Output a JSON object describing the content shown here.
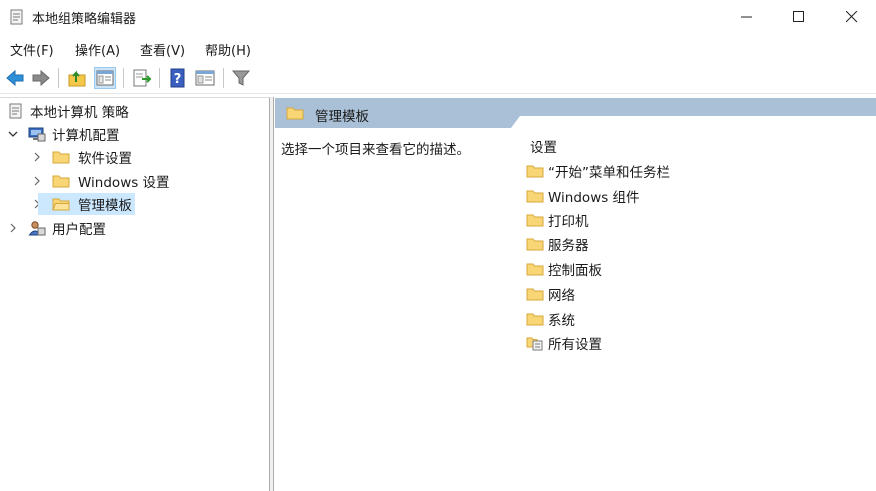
{
  "window": {
    "title": "本地组策略编辑器",
    "controls": [
      "minimize",
      "maximize",
      "close"
    ]
  },
  "menu": [
    "文件(F)",
    "操作(A)",
    "查看(V)",
    "帮助(H)"
  ],
  "toolbar": {
    "buttons": [
      "back-arrow-icon",
      "forward-arrow-icon",
      "up-folder-icon",
      "show-hide-tree-icon",
      "export-list-icon",
      "help-icon",
      "extended-view-icon",
      "filter-icon"
    ]
  },
  "tree": {
    "root": "本地计算机 策略",
    "computer_config": "计算机配置",
    "software_settings": "软件设置",
    "windows_settings": "Windows 设置",
    "admin_templates": "管理模板",
    "user_config": "用户配置"
  },
  "right": {
    "header_title": "管理模板",
    "description": "选择一个项目来查看它的描述。",
    "column_header": "设置",
    "items": [
      {
        "label": "“开始”菜单和任务栏",
        "icon": "folder-icon"
      },
      {
        "label": "Windows 组件",
        "icon": "folder-icon"
      },
      {
        "label": "打印机",
        "icon": "folder-icon"
      },
      {
        "label": "服务器",
        "icon": "folder-icon"
      },
      {
        "label": "控制面板",
        "icon": "folder-icon"
      },
      {
        "label": "网络",
        "icon": "folder-icon"
      },
      {
        "label": "系统",
        "icon": "folder-icon"
      },
      {
        "label": "所有设置",
        "icon": "all-settings-icon"
      }
    ]
  },
  "colors": {
    "selected_row": "#cce8ff",
    "header_band": "#a9c0d6",
    "folder_fill": "#f8d675",
    "folder_stroke": "#d7a73a"
  }
}
